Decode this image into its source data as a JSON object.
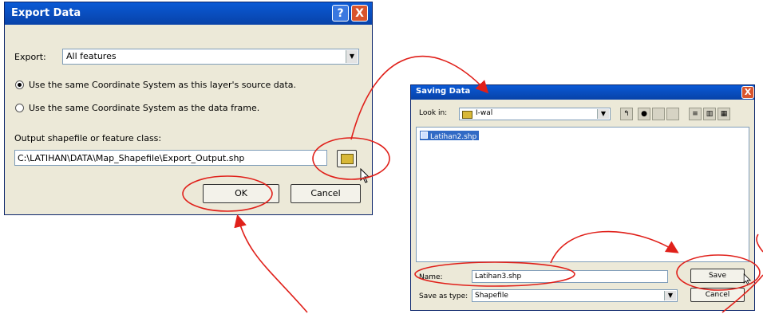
{
  "export_dialog": {
    "title": "Export Data",
    "help_glyph": "?",
    "close_glyph": "X",
    "export_label": "Export:",
    "export_value": "All features",
    "radio1_label": "Use the same Coordinate System as this layer's source data.",
    "radio2_label": "Use the same Coordinate System as the data frame.",
    "output_label": "Output shapefile or feature class:",
    "output_path": "C:\\LATIHAN\\DATA\\Map_Shapefile\\Export_Output.shp",
    "ok_label": "OK",
    "cancel_label": "Cancel"
  },
  "saving_dialog": {
    "title": "Saving Data",
    "close_glyph": "X",
    "look_in_label": "Look in:",
    "look_in_value": "I-wal",
    "file_item": "Latihan2.shp",
    "name_label": "Name:",
    "name_value": "Latihan3.shp",
    "save_type_label": "Save as type:",
    "save_type_value": "Shapefile",
    "save_label": "Save",
    "cancel_label": "Cancel"
  },
  "annotation_color": "#e0201a"
}
